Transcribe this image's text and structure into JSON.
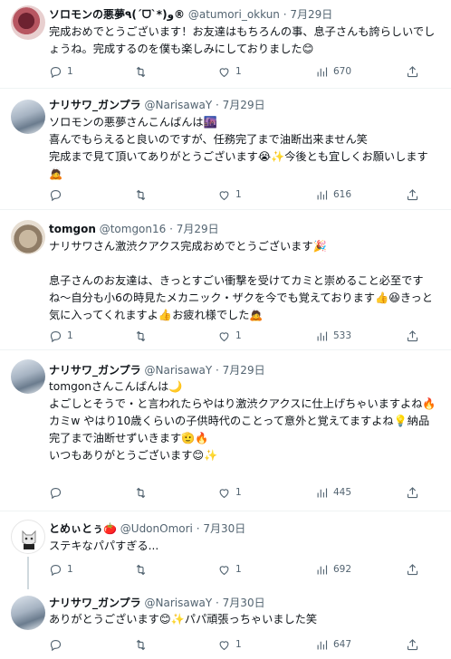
{
  "tweets": [
    {
      "name": "ソロモンの悪夢٩(ˊᗜˋ*)و®",
      "handle": "@atumori_okkun",
      "dot": "·",
      "date": "7月29日",
      "text": "完成おめでとうございます！お友達はもちろんの事、息子さんも誇らしいでしょうね。完成するのを僕も楽しみにしておりました😊",
      "replies": "1",
      "retweets": "",
      "likes": "1",
      "views": "670"
    },
    {
      "name": "ナリサワ_ガンプラ",
      "handle": "@NarisawaY",
      "dot": "·",
      "date": "7月29日",
      "text": "ソロモンの悪夢さんこんばんは🌆\n喜んでもらえると良いのですが、任務完了まで油断出来ません笑\n完成まで見て頂いてありがとうございます😭✨今後とも宜しくお願いします🙇",
      "replies": "",
      "retweets": "",
      "likes": "1",
      "views": "616"
    },
    {
      "name": "tomgon",
      "handle": "@tomgon16",
      "dot": "·",
      "date": "7月29日",
      "text": "ナリサワさん激渋クアクス完成おめでとうございます🎉\n\n息子さんのお友達は、きっとすごい衝撃を受けてカミと崇めること必至ですね〜自分も小6の時見たメカニック・ザクを今でも覚えております👍😆きっと気に入ってくれますよ👍お疲れ様でした🙇",
      "replies": "1",
      "retweets": "",
      "likes": "1",
      "views": "533"
    },
    {
      "name": "ナリサワ_ガンプラ",
      "handle": "@NarisawaY",
      "dot": "·",
      "date": "7月29日",
      "text": "tomgonさんこんばんは🌙\nよごしとそうで・と言われたらやはり激渋クアクスに仕上げちゃいますよね🔥\nカミw やはり10歳くらいの子供時代のことって意外と覚えてますよね💡納品完了まで油断せずいきます🫡🔥\nいつもありがとうございます😊✨",
      "replies": "",
      "retweets": "",
      "likes": "1",
      "views": "445"
    },
    {
      "name": "とめぃとぅ🍅",
      "handle": "@UdonOmori",
      "dot": "·",
      "date": "7月30日",
      "text": "ステキなパパすぎる...",
      "replies": "1",
      "retweets": "",
      "likes": "1",
      "views": "692"
    },
    {
      "name": "ナリサワ_ガンプラ",
      "handle": "@NarisawaY",
      "dot": "·",
      "date": "7月30日",
      "text": "ありがとうございます😊✨パパ頑張っちゃいました笑",
      "replies": "",
      "retweets": "",
      "likes": "1",
      "views": "647"
    }
  ]
}
